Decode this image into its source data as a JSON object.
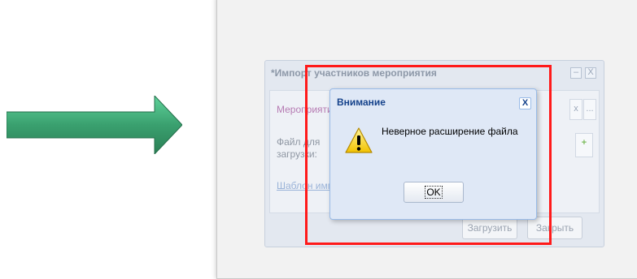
{
  "import_window": {
    "title": "*Импорт участников мероприятия",
    "minimize_glyph": "–",
    "close_glyph": "X",
    "event_label": "Мероприяти",
    "file_label": "Файл для загрузки:",
    "template_link": "Шаблон импо",
    "clear_glyph": "x",
    "more_glyph": "...",
    "upload_button": "Загрузить",
    "close_button": "Закрыть"
  },
  "dialog": {
    "title": "Внимание",
    "close_glyph": "X",
    "message": "Неверное расширение файла",
    "ok_label": "OK",
    "icon": "warning-icon"
  },
  "colors": {
    "arrow": "#3aa06f",
    "highlight": "#ff1a1a",
    "dialog_title": "#15428b"
  }
}
